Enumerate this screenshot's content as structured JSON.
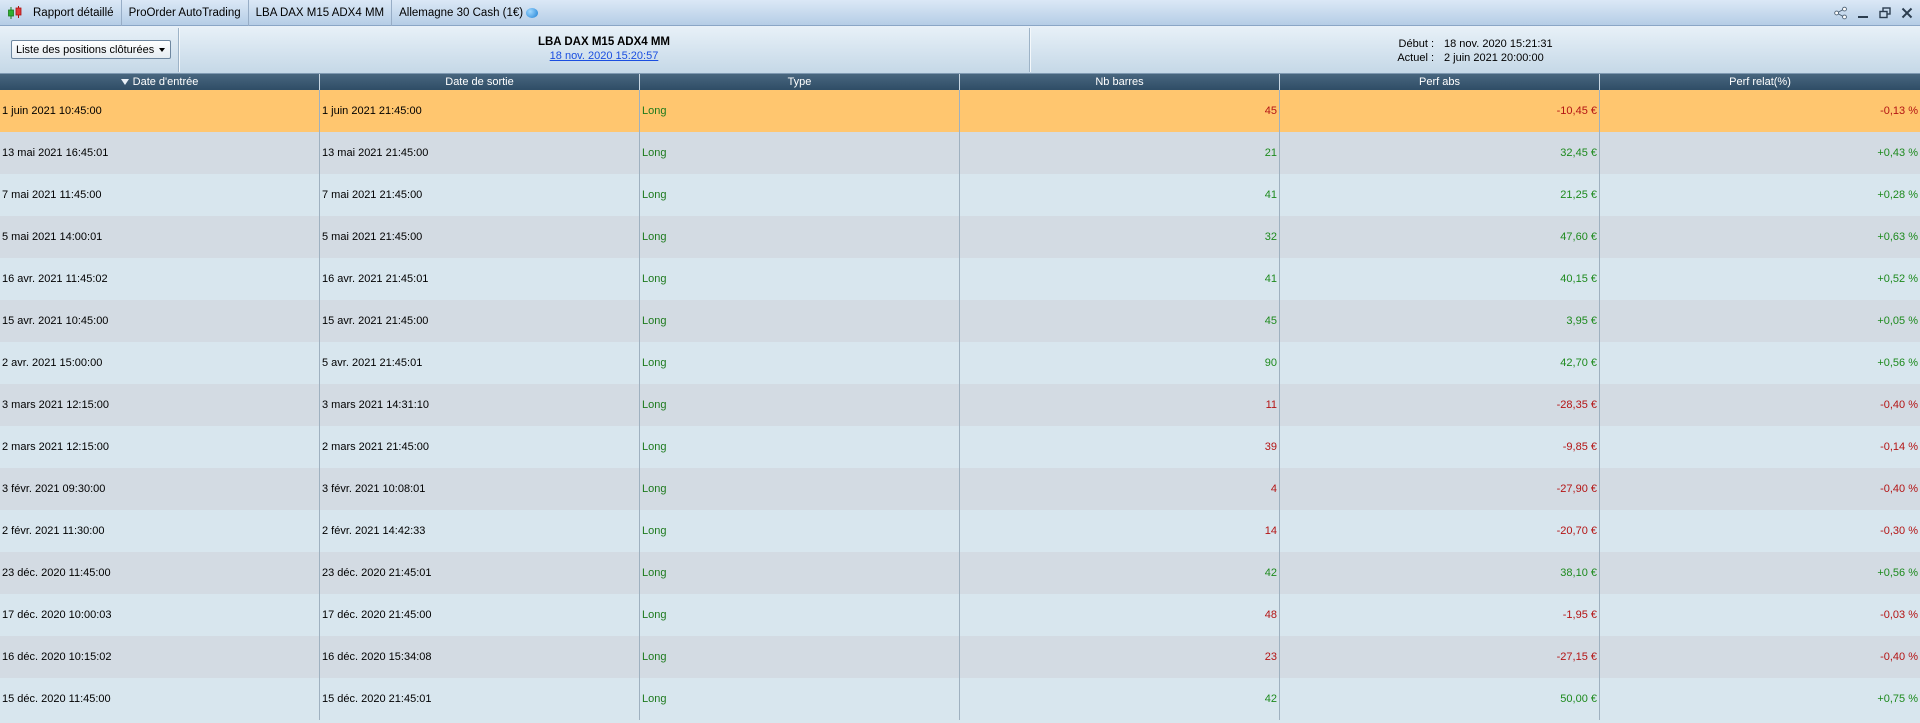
{
  "titlebar": {
    "crumbs": [
      "Rapport détaillé",
      "ProOrder AutoTrading",
      "LBA DAX M15 ADX4 MM",
      "Allemagne 30 Cash (1€)"
    ]
  },
  "infobar": {
    "dropdown_label": "Liste des positions clôturées",
    "strategy_name": "LBA DAX M15 ADX4 MM",
    "strategy_date": "18 nov. 2020 15:20:57",
    "start_label": "Début :",
    "start_value": "18 nov. 2020 15:21:31",
    "current_label": "Actuel :",
    "current_value": "2 juin 2021 20:00:00"
  },
  "table": {
    "columns": [
      "Date d'entrée",
      "Date de sortie",
      "Type",
      "Nb barres",
      "Perf abs",
      "Perf relat(%)"
    ],
    "rows": [
      {
        "entry": "1 juin 2021 10:45:00",
        "exit": "1 juin 2021 21:45:00",
        "type": "Long",
        "bars": "45",
        "abs": "-10,45 €",
        "rel": "-0,13 %",
        "positive": false,
        "selected": true
      },
      {
        "entry": "13 mai 2021 16:45:01",
        "exit": "13 mai 2021 21:45:00",
        "type": "Long",
        "bars": "21",
        "abs": "32,45 €",
        "rel": "+0,43 %",
        "positive": true
      },
      {
        "entry": "7 mai 2021 11:45:00",
        "exit": "7 mai 2021 21:45:00",
        "type": "Long",
        "bars": "41",
        "abs": "21,25 €",
        "rel": "+0,28 %",
        "positive": true
      },
      {
        "entry": "5 mai 2021 14:00:01",
        "exit": "5 mai 2021 21:45:00",
        "type": "Long",
        "bars": "32",
        "abs": "47,60 €",
        "rel": "+0,63 %",
        "positive": true
      },
      {
        "entry": "16 avr. 2021 11:45:02",
        "exit": "16 avr. 2021 21:45:01",
        "type": "Long",
        "bars": "41",
        "abs": "40,15 €",
        "rel": "+0,52 %",
        "positive": true
      },
      {
        "entry": "15 avr. 2021 10:45:00",
        "exit": "15 avr. 2021 21:45:00",
        "type": "Long",
        "bars": "45",
        "abs": "3,95 €",
        "rel": "+0,05 %",
        "positive": true
      },
      {
        "entry": "2 avr. 2021 15:00:00",
        "exit": "5 avr. 2021 21:45:01",
        "type": "Long",
        "bars": "90",
        "abs": "42,70 €",
        "rel": "+0,56 %",
        "positive": true
      },
      {
        "entry": "3 mars 2021 12:15:00",
        "exit": "3 mars 2021 14:31:10",
        "type": "Long",
        "bars": "11",
        "abs": "-28,35 €",
        "rel": "-0,40 %",
        "positive": false
      },
      {
        "entry": "2 mars 2021 12:15:00",
        "exit": "2 mars 2021 21:45:00",
        "type": "Long",
        "bars": "39",
        "abs": "-9,85 €",
        "rel": "-0,14 %",
        "positive": false
      },
      {
        "entry": "3 févr. 2021 09:30:00",
        "exit": "3 févr. 2021 10:08:01",
        "type": "Long",
        "bars": "4",
        "abs": "-27,90 €",
        "rel": "-0,40 %",
        "positive": false
      },
      {
        "entry": "2 févr. 2021 11:30:00",
        "exit": "2 févr. 2021 14:42:33",
        "type": "Long",
        "bars": "14",
        "abs": "-20,70 €",
        "rel": "-0,30 %",
        "positive": false
      },
      {
        "entry": "23 déc. 2020 11:45:00",
        "exit": "23 déc. 2020 21:45:01",
        "type": "Long",
        "bars": "42",
        "abs": "38,10 €",
        "rel": "+0,56 %",
        "positive": true
      },
      {
        "entry": "17 déc. 2020 10:00:03",
        "exit": "17 déc. 2020 21:45:00",
        "type": "Long",
        "bars": "48",
        "abs": "-1,95 €",
        "rel": "-0,03 %",
        "positive": false
      },
      {
        "entry": "16 déc. 2020 10:15:02",
        "exit": "16 déc. 2020 15:34:08",
        "type": "Long",
        "bars": "23",
        "abs": "-27,15 €",
        "rel": "-0,40 %",
        "positive": false
      },
      {
        "entry": "15 déc. 2020 11:45:00",
        "exit": "15 déc. 2020 21:45:01",
        "type": "Long",
        "bars": "42",
        "abs": "50,00 €",
        "rel": "+0,75 %",
        "positive": true
      }
    ]
  },
  "colors": {
    "positive": "#1d8a1d",
    "negative": "#b41414",
    "selected_row": "#ffc66f",
    "header_bg": "#3b5973"
  },
  "icons": {
    "app": "candlestick-chart-icon",
    "connection": "blue-bubble-icon",
    "share": "share-icon",
    "minimize": "minimize-icon",
    "restore": "restore-icon",
    "close": "close-icon"
  }
}
